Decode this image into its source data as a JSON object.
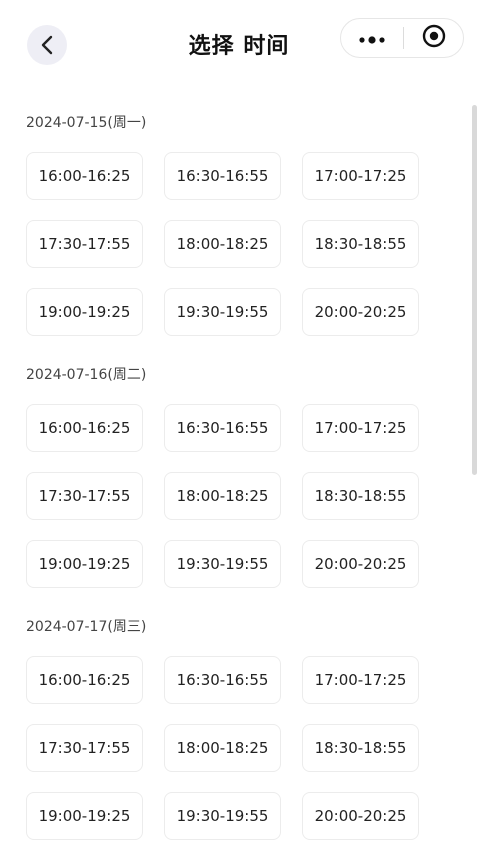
{
  "header": {
    "title": "选择  时间"
  },
  "dates": [
    {
      "label": "2024-07-15(周一)",
      "slots": [
        "16:00-16:25",
        "16:30-16:55",
        "17:00-17:25",
        "17:30-17:55",
        "18:00-18:25",
        "18:30-18:55",
        "19:00-19:25",
        "19:30-19:55",
        "20:00-20:25"
      ]
    },
    {
      "label": "2024-07-16(周二)",
      "slots": [
        "16:00-16:25",
        "16:30-16:55",
        "17:00-17:25",
        "17:30-17:55",
        "18:00-18:25",
        "18:30-18:55",
        "19:00-19:25",
        "19:30-19:55",
        "20:00-20:25"
      ]
    },
    {
      "label": "2024-07-17(周三)",
      "slots": [
        "16:00-16:25",
        "16:30-16:55",
        "17:00-17:25",
        "17:30-17:55",
        "18:00-18:25",
        "18:30-18:55",
        "19:00-19:25",
        "19:30-19:55",
        "20:00-20:25"
      ]
    }
  ],
  "icons": {
    "back": "chevron-left-icon",
    "more": "more-dots-icon",
    "close": "target-circle-icon"
  },
  "colors": {
    "back_bg": "#eeeef5",
    "slot_border": "#ececec",
    "scrollbar": "#d9d9d9"
  }
}
